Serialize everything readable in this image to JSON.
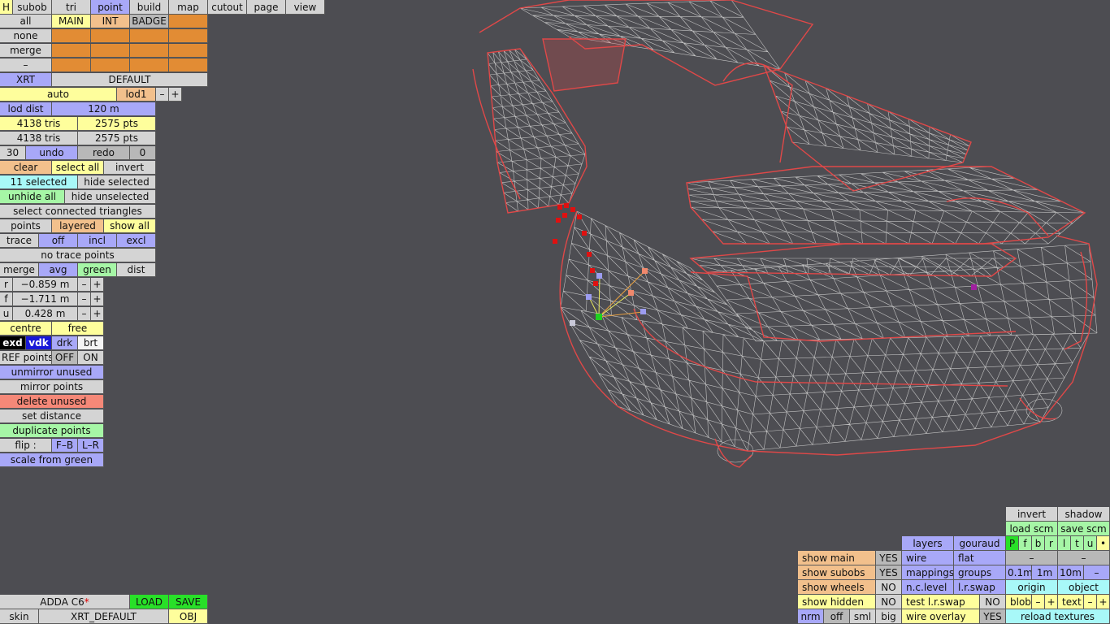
{
  "menu": {
    "h": "H",
    "subob": "subob",
    "tri": "tri",
    "point": "point",
    "build": "build",
    "map": "map",
    "cutout": "cutout",
    "page": "page",
    "view": "view"
  },
  "layers": {
    "all": "all",
    "none": "none",
    "merge": "merge",
    "dash": "–",
    "main": "MAIN",
    "int": "INT",
    "badge": "BADGE"
  },
  "xrt": {
    "xrt": "XRT",
    "default": "DEFAULT"
  },
  "lod": {
    "auto": "auto",
    "lod1": "lod1",
    "minus": "–",
    "plus": "+",
    "lod_dist": "lod dist",
    "lod_dist_val": "120 m"
  },
  "stats": {
    "tris1": "4138 tris",
    "pts1": "2575 pts",
    "tris2": "4138 tris",
    "pts2": "2575 pts"
  },
  "undo": {
    "count": "30",
    "undo": "undo",
    "redo": "redo",
    "zero": "0"
  },
  "select": {
    "clear": "clear",
    "select_all": "select all",
    "invert": "invert",
    "selected": "11 selected",
    "hide_selected": "hide selected",
    "unhide_all": "unhide all",
    "hide_unselected": "hide unselected",
    "connected": "select connected triangles"
  },
  "points": {
    "points": "points",
    "layered": "layered",
    "show_all": "show all"
  },
  "trace": {
    "trace": "trace",
    "off": "off",
    "incl": "incl",
    "excl": "excl",
    "no_trace": "no trace points"
  },
  "merge": {
    "merge": "merge",
    "avg": "avg",
    "green": "green",
    "dist": "dist"
  },
  "coords": {
    "r_label": "r",
    "r_val": "−0.859 m",
    "f_label": "f",
    "f_val": "−1.711 m",
    "u_label": "u",
    "u_val": "0.428 m",
    "minus": "–",
    "plus": "+"
  },
  "centre": {
    "centre": "centre",
    "free": "free"
  },
  "shade": {
    "exd": "exd",
    "vdk": "vdk",
    "drk": "drk",
    "brt": "brt"
  },
  "ref": {
    "label": "REF points",
    "off": "OFF",
    "on": "ON"
  },
  "actions": {
    "unmirror": "unmirror unused",
    "mirror": "mirror points",
    "delete": "delete unused",
    "set_distance": "set distance",
    "duplicate": "duplicate points",
    "flip": "flip :",
    "fb": "F–B",
    "lr": "L–R",
    "scale": "scale from green"
  },
  "file": {
    "name": "ADDA C6",
    "modified_mark": "*",
    "load": "LOAD",
    "save": "SAVE",
    "skin": "skin",
    "skin_val": "XRT_DEFAULT",
    "obj": "OBJ"
  },
  "view": {
    "show_main": "show main",
    "show_subobs": "show subobs",
    "show_wheels": "show wheels",
    "show_hidden": "show hidden",
    "yes": "YES",
    "no": "NO",
    "layers": "layers",
    "gouraud": "gouraud",
    "wire": "wire",
    "flat": "flat",
    "mappings": "mappings",
    "groups": "groups",
    "nc_level": "n.c.level",
    "lr_swap": "l.r.swap",
    "test_lr_swap": "test l.r.swap",
    "wire_overlay": "wire overlay",
    "nrm": "nrm",
    "off": "off",
    "sml": "sml",
    "big": "big",
    "invert": "invert",
    "shadow": "shadow",
    "load_scm": "load scm",
    "save_scm": "save scm",
    "p": "P",
    "f": "f",
    "b": "b",
    "r": "r",
    "l": "l",
    "t": "t",
    "u": "u",
    "dot": "•",
    "dash": "–",
    "g01": "0.1m",
    "g1": "1m",
    "g10": "10m",
    "origin": "origin",
    "object": "object",
    "blob": "blob",
    "text": "text",
    "minus": "–",
    "plus": "+",
    "reload": "reload textures"
  },
  "colors": {
    "wire": "#c8c8c8",
    "outline": "#e04848",
    "selected_point": "#e01010",
    "background": "#4d4d52"
  }
}
